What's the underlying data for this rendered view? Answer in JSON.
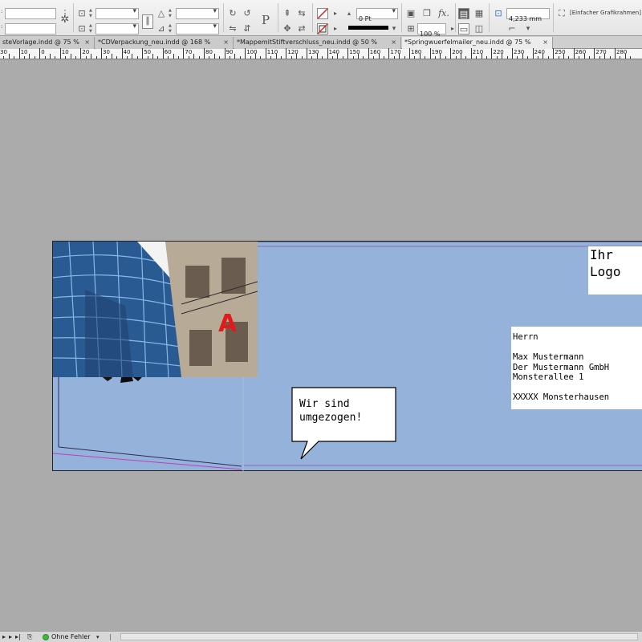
{
  "control_panel": {
    "stroke_weight": "0 Pt",
    "opacity": "100 %",
    "fx_label": "fx.",
    "corner_size": "4,233 mm",
    "object_style": "[Einfacher Grafikrahmen]",
    "paragraph_icon_label": "P"
  },
  "tabs": [
    {
      "label": "steVorlage.indd @ 75 %"
    },
    {
      "label": "*CDVerpackung_neu.indd @ 168 %"
    },
    {
      "label": "*MappemitStiftverschluss_neu.indd @ 50 %"
    },
    {
      "label": "*Springwuerfelmailer_neu.indd @ 75 %"
    }
  ],
  "tab_close_glyph": "×",
  "ruler": {
    "labels": [
      "30",
      "10",
      "0",
      "10",
      "20",
      "30",
      "40",
      "50",
      "60",
      "70",
      "80",
      "90",
      "100",
      "110",
      "120",
      "130",
      "140",
      "150",
      "160",
      "170",
      "180",
      "190",
      "200",
      "210",
      "220",
      "230",
      "240",
      "250",
      "260",
      "270",
      "280"
    ]
  },
  "document": {
    "logo": {
      "line1": "Ihr",
      "line2": "Logo"
    },
    "address": [
      "Herrn",
      "",
      "Max Mustermann",
      "Der Mustermann GmbH",
      "Monsterallee 1",
      "",
      "XXXXX Monsterhausen"
    ],
    "speech_bubble": {
      "line1": "Wir sind",
      "line2": "umgezogen!"
    },
    "building_sign_letter": "A"
  },
  "status_bar": {
    "preflight_status": "Ohne Fehler",
    "preflight_color": "#3fb63f"
  },
  "colors": {
    "page_fill": "#95b3da",
    "pasteboard": "#ababab",
    "fold_line": "#c03cc0"
  }
}
